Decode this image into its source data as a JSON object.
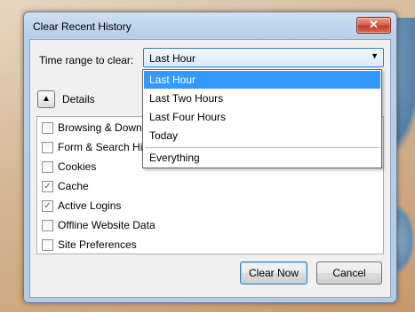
{
  "dialog": {
    "title": "Clear Recent History",
    "close_glyph": "✕"
  },
  "time_range": {
    "label": "Time range to clear:",
    "selected": "Last Hour",
    "options": [
      "Last Hour",
      "Last Two Hours",
      "Last Four Hours",
      "Today",
      "Everything"
    ]
  },
  "details": {
    "label": "Details",
    "expanded": true,
    "toggle_icon": "chevron-up-icon"
  },
  "items": [
    {
      "label": "Browsing & Download History",
      "checked": false
    },
    {
      "label": "Form & Search History",
      "checked": false
    },
    {
      "label": "Cookies",
      "checked": false
    },
    {
      "label": "Cache",
      "checked": true
    },
    {
      "label": "Active Logins",
      "checked": true
    },
    {
      "label": "Offline Website Data",
      "checked": false
    },
    {
      "label": "Site Preferences",
      "checked": false
    }
  ],
  "buttons": {
    "clear_now": "Clear Now",
    "cancel": "Cancel"
  }
}
